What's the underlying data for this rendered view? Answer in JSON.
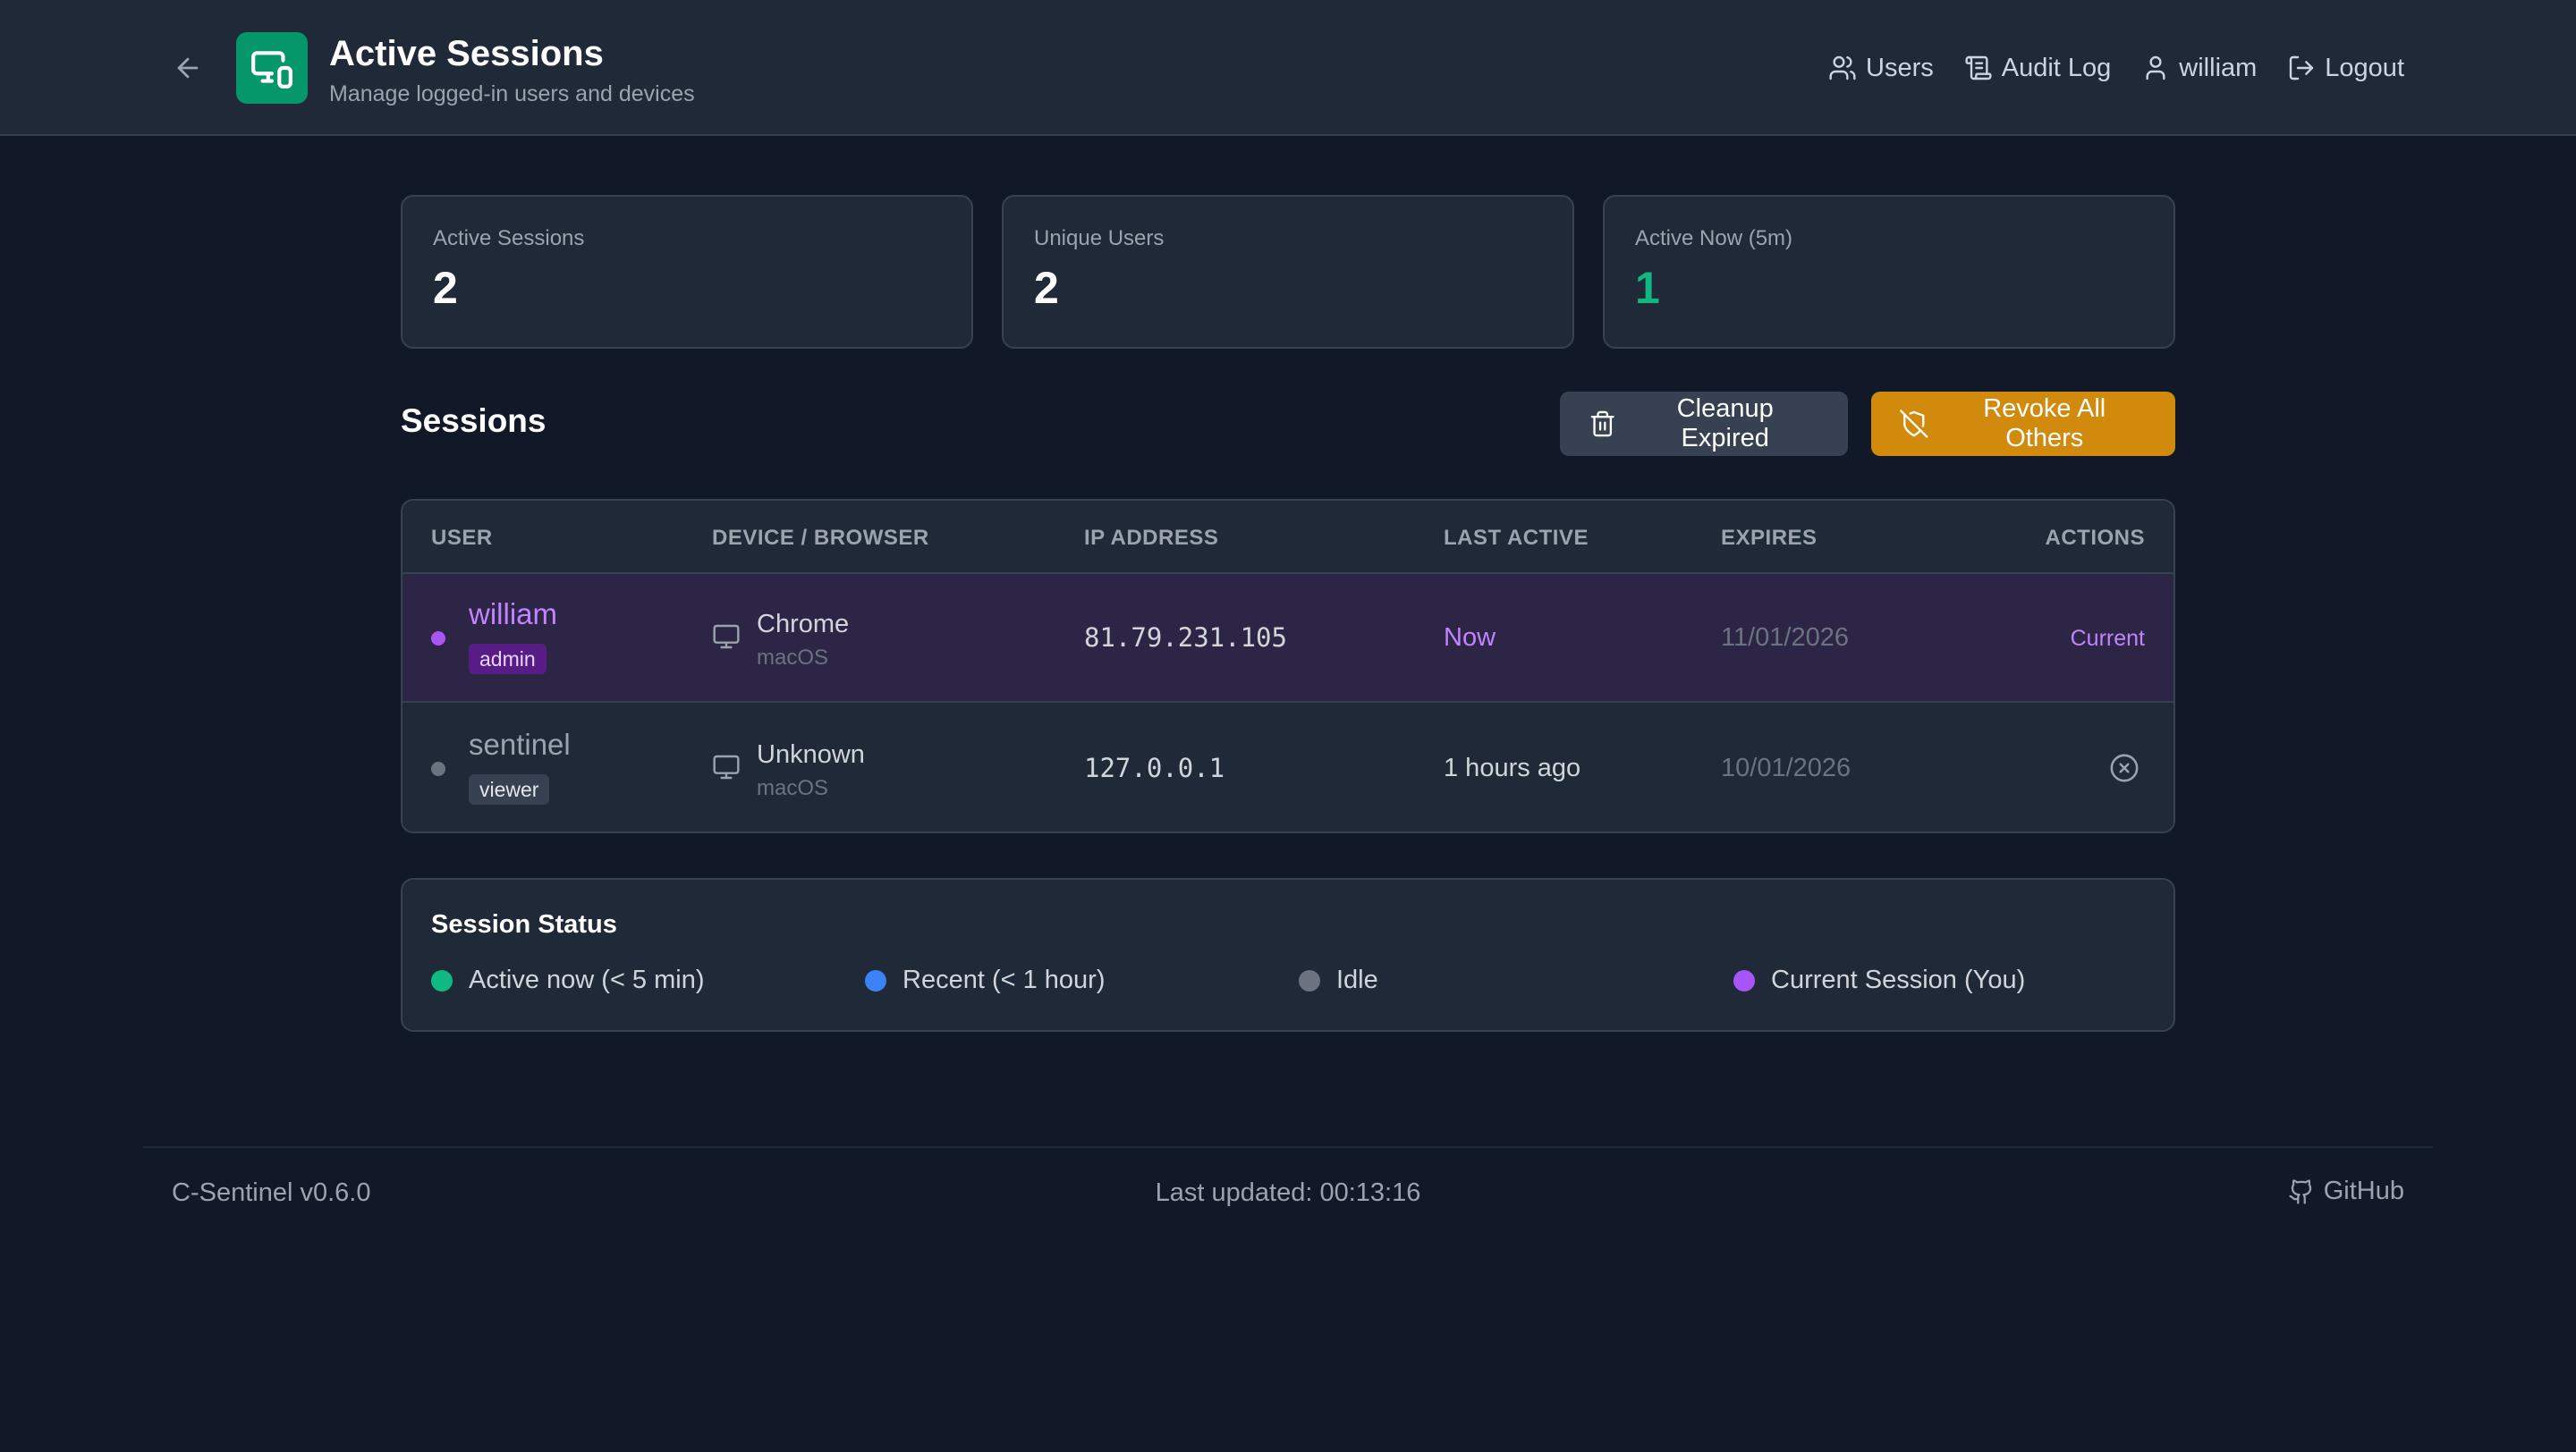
{
  "header": {
    "title": "Active Sessions",
    "subtitle": "Manage logged-in users and devices",
    "nav": {
      "users": "Users",
      "audit_log": "Audit Log",
      "user": "william",
      "logout": "Logout"
    }
  },
  "stats": [
    {
      "label": "Active Sessions",
      "value": "2"
    },
    {
      "label": "Unique Users",
      "value": "2"
    },
    {
      "label": "Active Now (5m)",
      "value": "1"
    }
  ],
  "sessions": {
    "title": "Sessions",
    "cleanup_label": "Cleanup Expired",
    "revoke_all_label": "Revoke All Others",
    "columns": [
      "USER",
      "DEVICE / BROWSER",
      "IP ADDRESS",
      "LAST ACTIVE",
      "EXPIRES",
      "ACTIONS"
    ],
    "rows": [
      {
        "user": "william",
        "role": "admin",
        "browser": "Chrome",
        "os": "macOS",
        "ip": "81.79.231.105",
        "last_active": "Now",
        "expires": "11/01/2026",
        "action": "Current",
        "status_color": "#a855f7"
      },
      {
        "user": "sentinel",
        "role": "viewer",
        "browser": "Unknown",
        "os": "macOS",
        "ip": "127.0.0.1",
        "last_active": "1 hours ago",
        "expires": "10/01/2026",
        "action": "revoke-icon",
        "status_color": "#6b7280"
      }
    ]
  },
  "legend": {
    "title": "Session Status",
    "items": [
      {
        "label": "Active now (< 5 min)",
        "color": "#10b981"
      },
      {
        "label": "Recent (< 1 hour)",
        "color": "#3b82f6"
      },
      {
        "label": "Idle",
        "color": "#6b7280"
      },
      {
        "label": "Current Session (You)",
        "color": "#a855f7"
      }
    ]
  },
  "footer": {
    "version": "C-Sentinel v0.6.0",
    "last_updated": "Last updated: 00:13:16",
    "github": "GitHub"
  },
  "colors": {
    "accent_green": "#059669",
    "warning": "#d18a0b",
    "current_purple": "#c084fc"
  }
}
